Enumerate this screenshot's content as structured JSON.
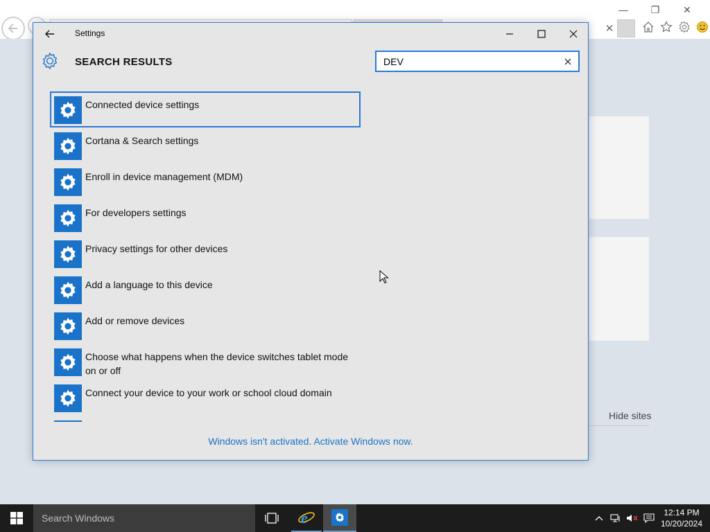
{
  "browser": {
    "hide_sites_label": "Hide sites"
  },
  "settings": {
    "window_title": "Settings",
    "header_title": "SEARCH RESULTS",
    "search": {
      "value": "DEV",
      "placeholder": ""
    },
    "results": [
      {
        "label": "Connected device settings",
        "focused": true
      },
      {
        "label": "Cortana & Search settings"
      },
      {
        "label": "Enroll in device management (MDM)"
      },
      {
        "label": "For developers settings"
      },
      {
        "label": "Privacy settings for other devices"
      },
      {
        "label": "Add a language to this device"
      },
      {
        "label": "Add or remove devices"
      },
      {
        "label": "Choose what happens when the device switches tablet mode on or off"
      },
      {
        "label": "Connect your device to your work or school cloud domain"
      }
    ],
    "activation_notice": "Windows isn't activated. Activate Windows now."
  },
  "taskbar": {
    "search_placeholder": "Search Windows",
    "clock_time": "12:14 PM",
    "clock_date": "10/20/2024"
  },
  "colors": {
    "accent": "#2b78d8",
    "icon_blue": "#1a73c8",
    "window_bg": "#e6e6e6",
    "taskbar_bg": "#1c1c1c"
  }
}
